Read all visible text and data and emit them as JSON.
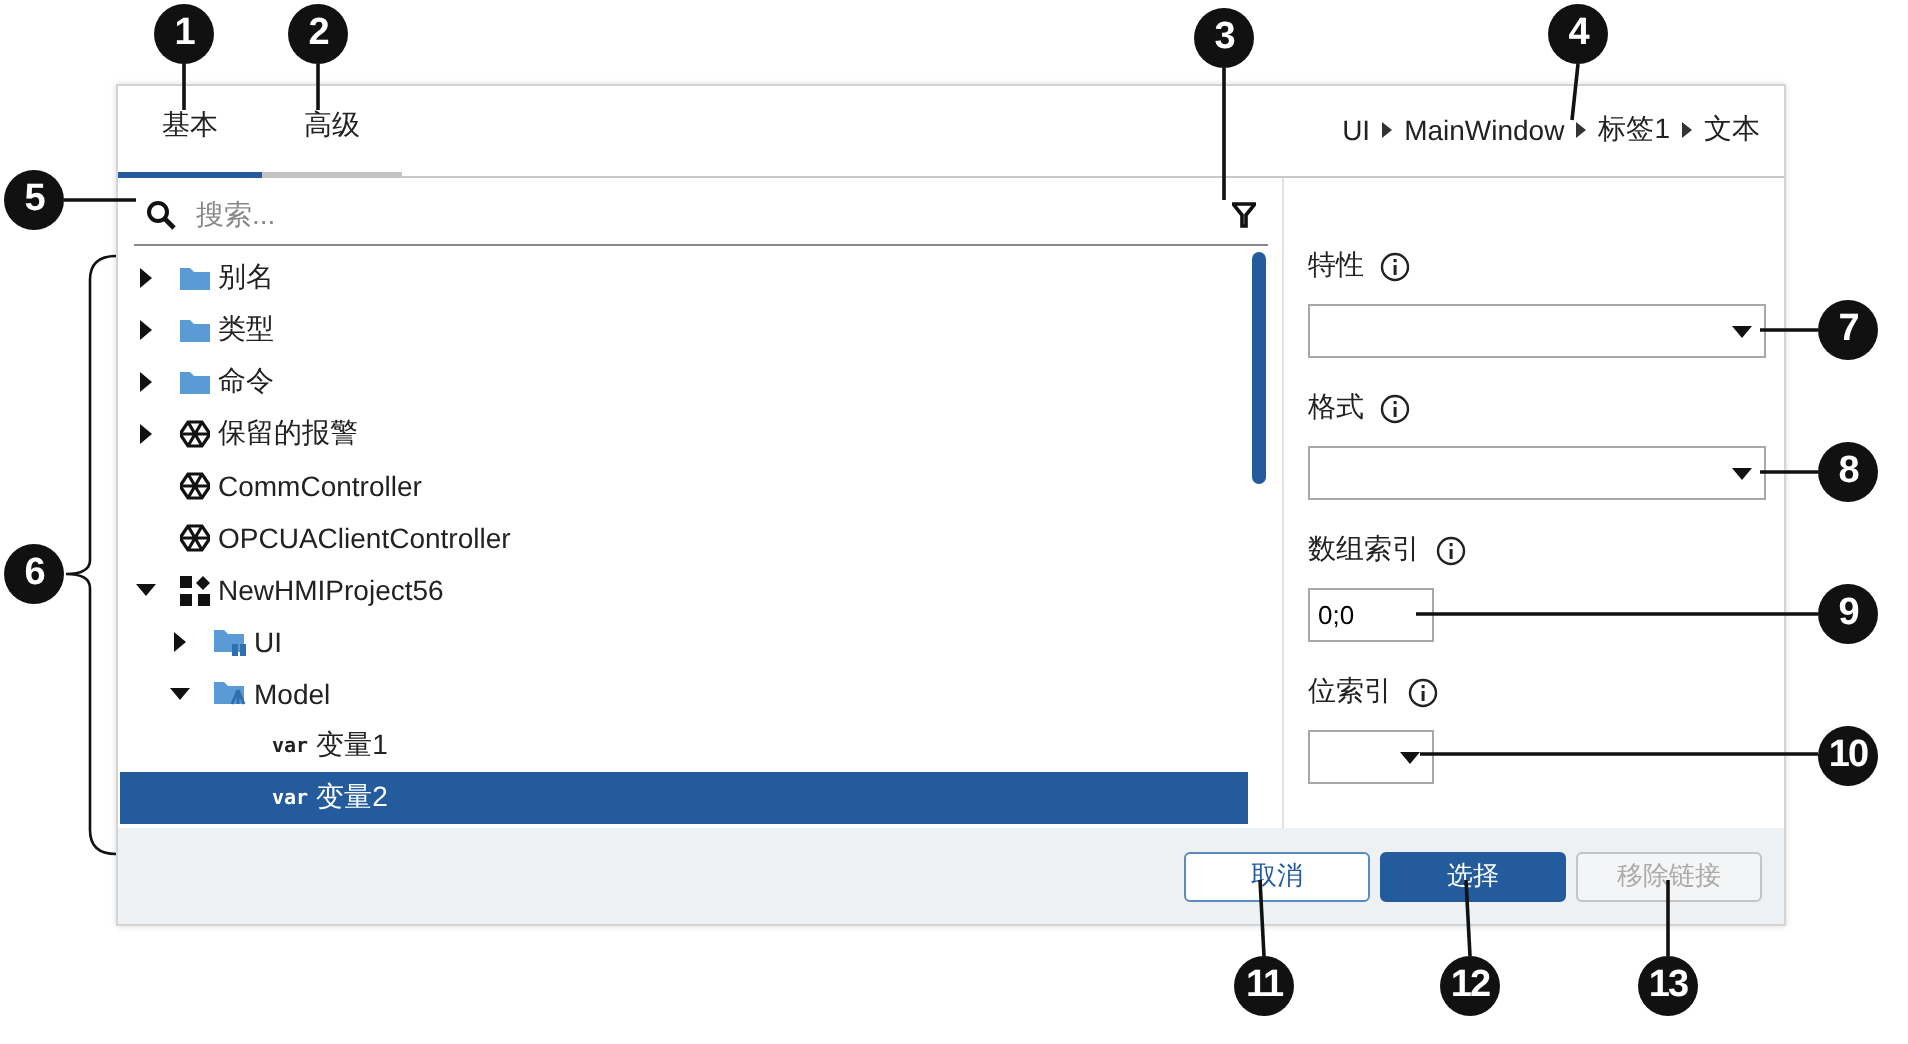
{
  "tabs": [
    {
      "label": "基本",
      "selected": true
    },
    {
      "label": "高级",
      "selected": false
    }
  ],
  "breadcrumb": [
    "UI",
    "MainWindow",
    "标签1",
    "文本"
  ],
  "search": {
    "placeholder": "搜索..."
  },
  "tree": [
    {
      "label": "别名",
      "kind": "folder",
      "expandable": true,
      "expanded": false,
      "selected": false
    },
    {
      "label": "类型",
      "kind": "folder",
      "expandable": true,
      "expanded": false,
      "selected": false
    },
    {
      "label": "命令",
      "kind": "folder",
      "expandable": true,
      "expanded": false,
      "selected": false
    },
    {
      "label": "保留的报警",
      "kind": "cluster",
      "expandable": true,
      "expanded": false,
      "selected": false
    },
    {
      "label": "CommController",
      "kind": "cluster",
      "expandable": false,
      "selected": false
    },
    {
      "label": "OPCUAClientController",
      "kind": "cluster",
      "expandable": false,
      "selected": false
    },
    {
      "label": "NewHMIProject56",
      "kind": "project",
      "expandable": true,
      "expanded": true,
      "selected": false,
      "children": [
        {
          "label": "UI",
          "kind": "ui-folder",
          "expandable": true,
          "expanded": false,
          "selected": false
        },
        {
          "label": "Model",
          "kind": "model-folder",
          "expandable": true,
          "expanded": true,
          "selected": false,
          "children": [
            {
              "label": "变量1",
              "kind": "var",
              "badge": "var",
              "expandable": false,
              "selected": false
            },
            {
              "label": "变量2",
              "kind": "var",
              "badge": "var",
              "expandable": false,
              "selected": true
            }
          ]
        }
      ]
    }
  ],
  "fields": [
    {
      "label": "特性",
      "kind": "select",
      "wide": true
    },
    {
      "label": "格式",
      "kind": "select",
      "wide": true
    },
    {
      "label": "数组索引",
      "kind": "input",
      "wide": false,
      "value": "0;0"
    },
    {
      "label": "位索引",
      "kind": "select",
      "wide": false
    }
  ],
  "buttons": [
    {
      "label": "取消",
      "kind": "secondary",
      "disabled": false
    },
    {
      "label": "选择",
      "kind": "primary",
      "disabled": false
    },
    {
      "label": "移除链接",
      "kind": "secondary",
      "disabled": true
    }
  ],
  "callouts": [
    {
      "label": "1"
    },
    {
      "label": "2"
    },
    {
      "label": "3"
    },
    {
      "label": "4"
    },
    {
      "label": "5"
    },
    {
      "label": "6"
    },
    {
      "label": "7"
    },
    {
      "label": "8"
    },
    {
      "label": "9"
    },
    {
      "label": "10"
    },
    {
      "label": "11"
    },
    {
      "label": "12"
    },
    {
      "label": "13"
    }
  ]
}
